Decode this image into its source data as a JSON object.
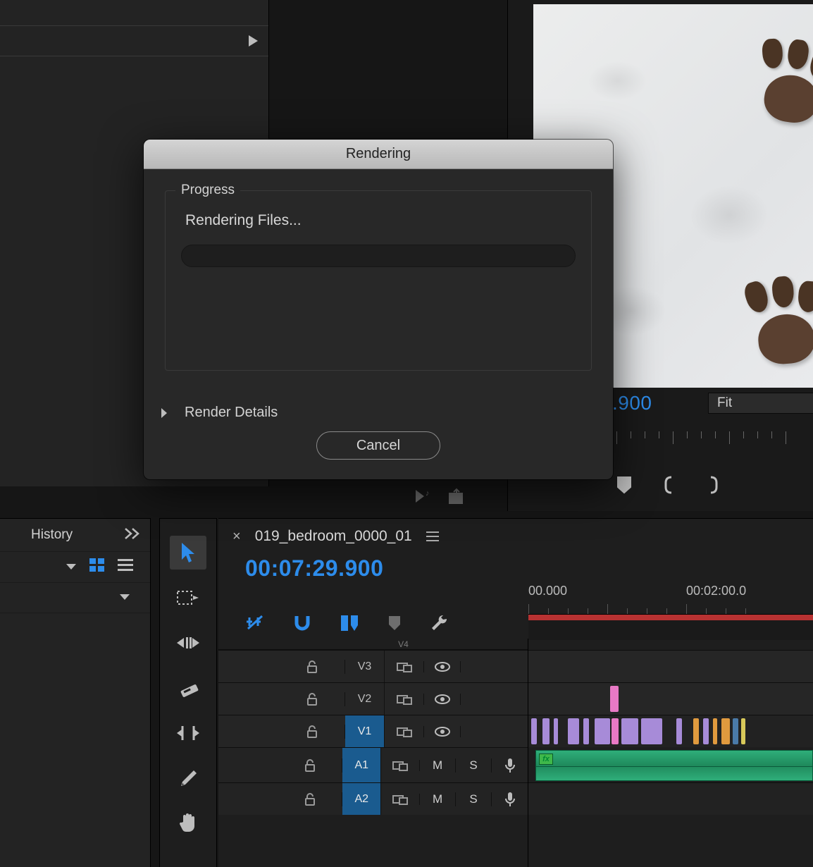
{
  "dialog": {
    "title": "Rendering",
    "progress_legend": "Progress",
    "status_text": "Rendering Files...",
    "details_label": "Render Details",
    "cancel_label": "Cancel"
  },
  "monitor": {
    "timecode_partial": ".900",
    "zoom_label": "Fit"
  },
  "history_panel": {
    "tab_label": "History"
  },
  "timeline": {
    "sequence_name": "019_bedroom_0000_01",
    "timecode": "00:07:29.900",
    "ruler": {
      "start_label": "00.000",
      "next_label": "00:02:00.0"
    },
    "tracks": {
      "v4": "V4",
      "v3": "V3",
      "v2": "V2",
      "v1": "V1",
      "a1": "A1",
      "a2": "A2",
      "mute": "M",
      "solo": "S"
    },
    "audio_fx": "fx"
  }
}
